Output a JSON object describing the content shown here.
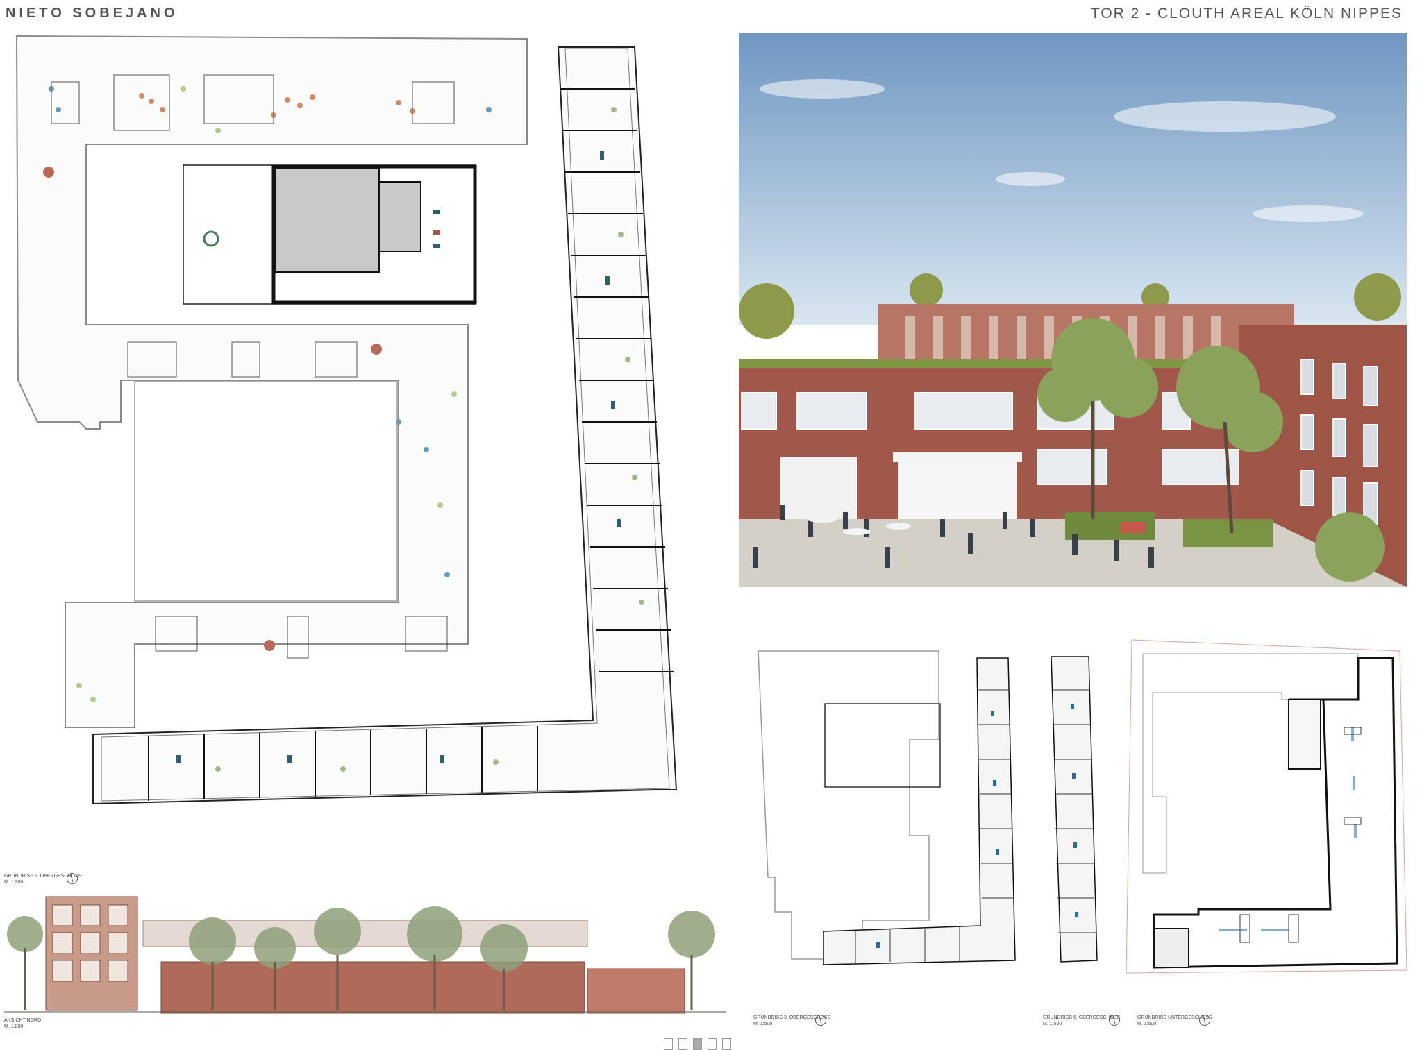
{
  "header": {
    "brand": "NIETO SOBEJANO",
    "title": "TOR 2 - CLOUTH AREAL KÖLN NIPPES"
  },
  "plans": {
    "main": {
      "label": "GRUNDRISS 1. OBERGESCHOSS",
      "scale": "M. 1:200"
    },
    "elevation": {
      "label": "ANSICHT NORD",
      "scale": "M. 1:200"
    },
    "plan_2": {
      "label": "GRUNDRISS 3. OBERGESCHOSS",
      "scale": "M. 1:500"
    },
    "plan_3": {
      "label": "GRUNDRISS 6. OBERGESCHOSS",
      "scale": "M. 1:500"
    },
    "plan_4": {
      "label": "GRUNDRISS UNTERGESCHOSS",
      "scale": "M. 1:500"
    }
  },
  "pager": {
    "pages": 5,
    "active": 3
  },
  "colors": {
    "brick": "#a0584a",
    "sky": "#8fb3d4",
    "paving": "#cfccc5",
    "wall": "#1a1a1a",
    "accent_teal": "#2f5e6e"
  },
  "icons": [
    "north-arrow-icon"
  ]
}
